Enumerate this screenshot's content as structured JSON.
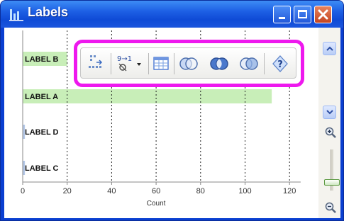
{
  "window": {
    "title": "Labels"
  },
  "chart_data": {
    "type": "bar",
    "orientation": "horizontal",
    "categories": [
      "LABEL B",
      "LABEL A",
      "LABEL D",
      "LABEL C"
    ],
    "values": [
      20,
      112,
      1,
      1
    ],
    "xlabel": "Count",
    "ylabel": "",
    "xlim": [
      0,
      125
    ],
    "x_ticks": [
      0,
      20,
      40,
      60,
      80,
      100,
      120
    ],
    "grid": "vertical dotted",
    "bar_color": "#c8eeb8",
    "small_bar_color": "#b4c8e8"
  },
  "toolbar": {
    "sort_icon_text": "9→1",
    "buttons": [
      "group-sort",
      "sort-order",
      "table-view",
      "venn-a",
      "venn-b",
      "venn-c",
      "help"
    ]
  },
  "colors": {
    "highlight": "#ee18ee",
    "title_bar": "#1d5fe4",
    "close": "#d8562e"
  }
}
